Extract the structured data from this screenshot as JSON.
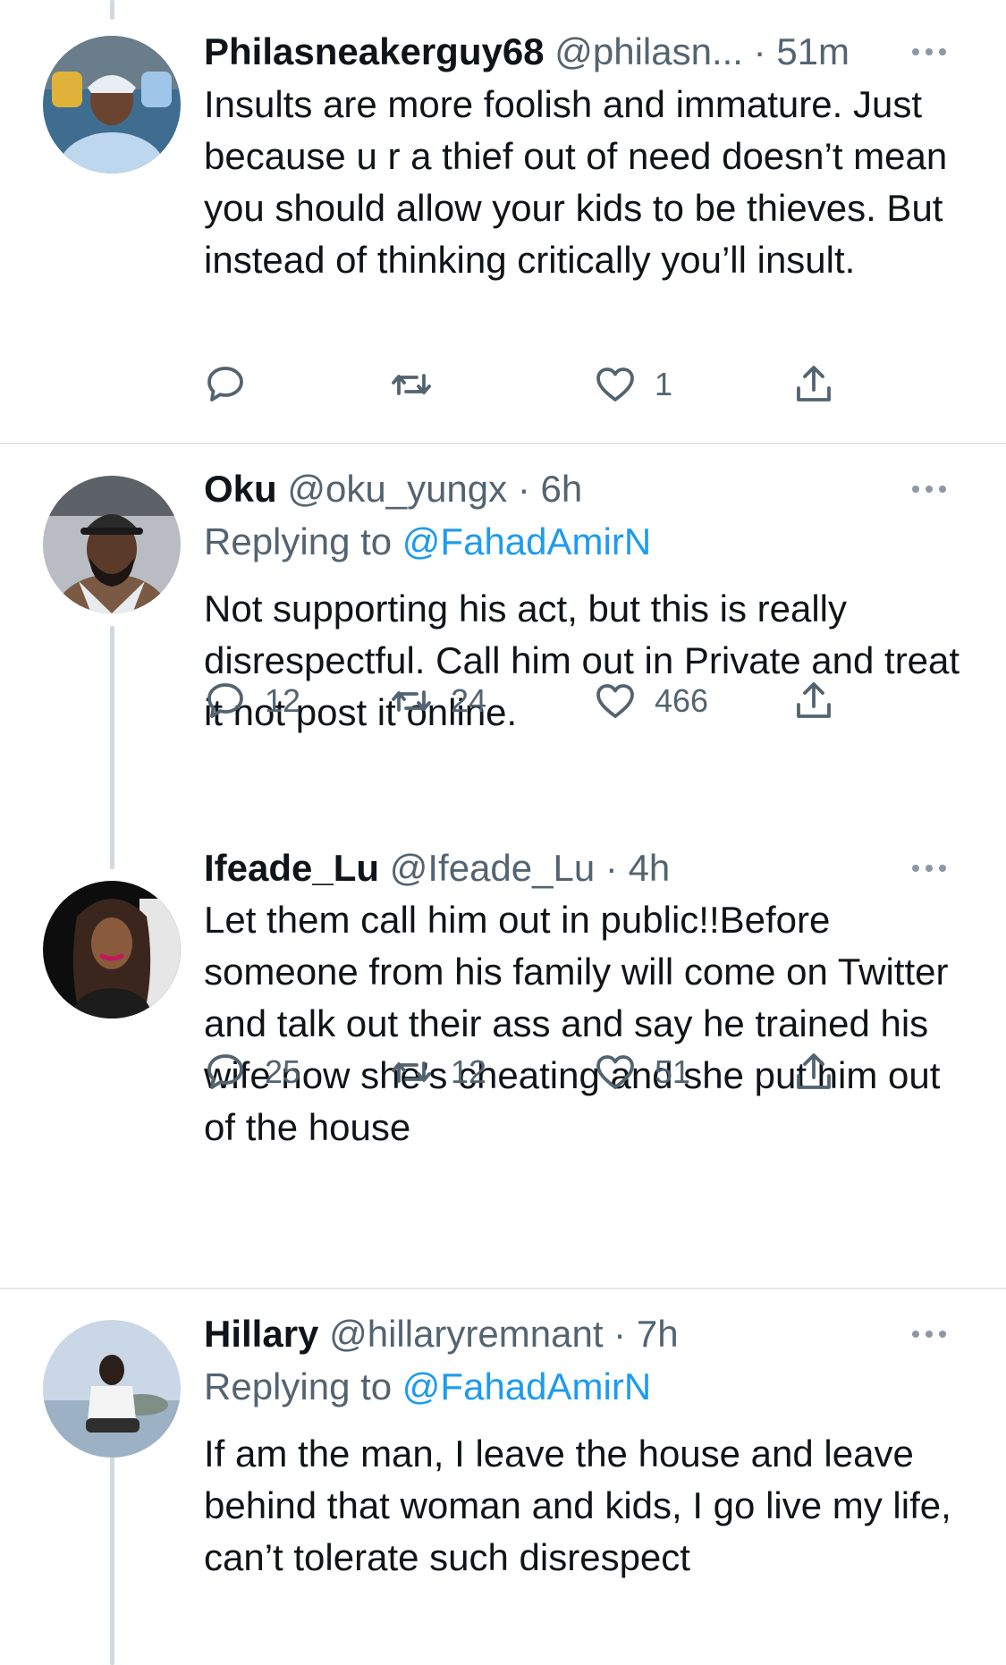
{
  "tweets": [
    {
      "name": "Philasneakerguy68",
      "handle": "@philasn...",
      "separator": "·",
      "time": "51m",
      "replying_prefix": "",
      "replying_mention": "",
      "text": "Insults are more foolish and immature. Just because u r a thief out of need doesn’t mean you should allow your kids to be thieves. But instead of thinking critically you’ll insult.",
      "counts": {
        "replies": "",
        "retweets": "",
        "likes": "1"
      }
    },
    {
      "name": "Oku",
      "handle": "@oku_yungx",
      "separator": "·",
      "time": "6h",
      "replying_prefix": "Replying to",
      "replying_mention": "@FahadAmirN",
      "text": "Not supporting his act, but this is really disrespectful. Call him out in Private and treat it not post it online.",
      "counts": {
        "replies": "12",
        "retweets": "24",
        "likes": "466"
      }
    },
    {
      "name": "Ifeade_Lu",
      "handle": "@Ifeade_Lu",
      "separator": "·",
      "time": "4h",
      "text": "Let them call him out in public!!Before someone from his family will come on Twitter and talk out their ass and say he trained his wife now she’s cheating and she put him out of the house",
      "counts": {
        "replies": "25",
        "retweets": "12",
        "likes": "51"
      }
    },
    {
      "name": "Hillary",
      "handle": "@hillaryremnant",
      "separator": "·",
      "time": "7h",
      "replying_prefix": "Replying to",
      "replying_mention": "@FahadAmirN",
      "text": "If am the man, I leave the house and leave behind that woman and kids, I go live my life, can’t tolerate such disrespect"
    }
  ],
  "icons": {
    "reply": "reply-icon",
    "retweet": "retweet-icon",
    "like": "heart-icon",
    "share": "share-icon",
    "more": "more-options-icon"
  },
  "colors": {
    "link": "#1d9bf0",
    "secondary_text": "#536471",
    "thread_line": "#cfd9de",
    "divider": "#e4e8eb"
  }
}
